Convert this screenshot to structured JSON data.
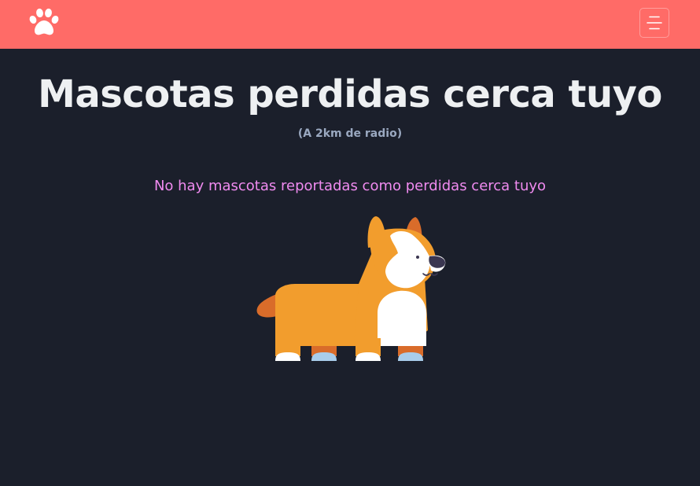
{
  "navbar": {
    "logo_icon": "paw-icon",
    "menu_icon": "hamburger-menu-icon",
    "background_color": "#ff6b67"
  },
  "main": {
    "title": "Mascotas perdidas cerca tuyo",
    "subtitle": "(A 2km de radio)",
    "empty_message": "No hay mascotas reportadas como perdidas cerca tuyo",
    "illustration": "corgi-dog-illustration"
  },
  "colors": {
    "background": "#1b1f2b",
    "title": "#eef0f2",
    "subtitle": "#9aa8c0",
    "empty_message": "#f08bf0"
  }
}
